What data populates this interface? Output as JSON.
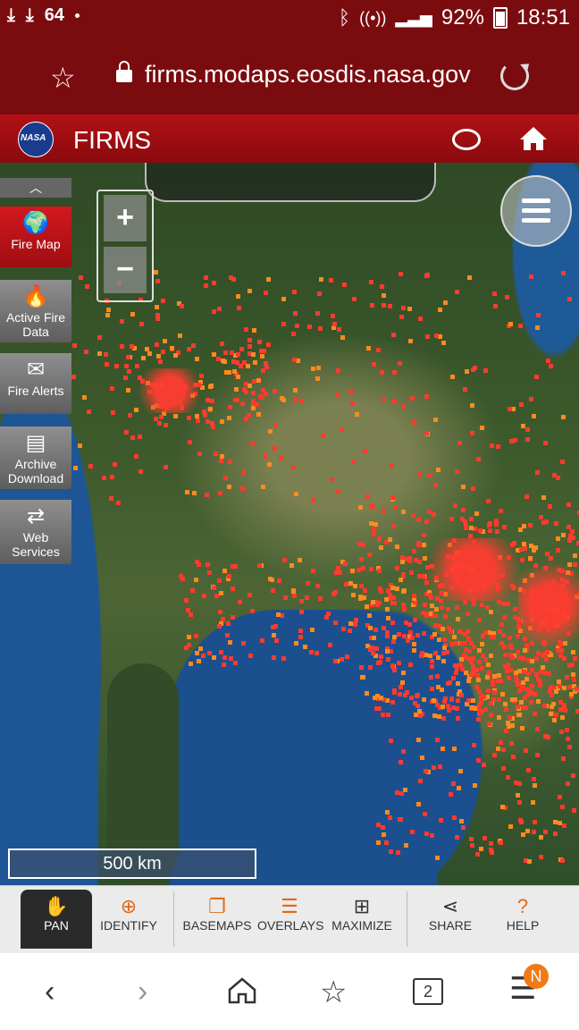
{
  "status_bar": {
    "notif_count": "64",
    "battery": "92%",
    "time": "18:51"
  },
  "browser": {
    "url": "firms.modaps.eosdis.nasa.gov",
    "tab_count": "2",
    "menu_badge": "N"
  },
  "app": {
    "logo_text": "NASA",
    "title": "FIRMS"
  },
  "sidebar": {
    "items": [
      {
        "label": "Fire Map",
        "icon": "globe-icon"
      },
      {
        "label": "Active Fire Data",
        "icon": "flame-icon"
      },
      {
        "label": "Fire Alerts",
        "icon": "envelope-icon"
      },
      {
        "label": "Archive Download",
        "icon": "archive-icon"
      },
      {
        "label": "Web Services",
        "icon": "arrows-icon"
      }
    ]
  },
  "map": {
    "zoom_in": "+",
    "zoom_out": "−",
    "scale_label": "500 km"
  },
  "toolbar": {
    "items": [
      {
        "label": "PAN",
        "icon": "hand-icon"
      },
      {
        "label": "IDENTIFY",
        "icon": "crosshair-icon"
      },
      {
        "label": "BASEMAPS",
        "icon": "layers-icon"
      },
      {
        "label": "OVERLAYS",
        "icon": "database-icon"
      },
      {
        "label": "MAXIMIZE",
        "icon": "maximize-icon"
      },
      {
        "label": "SHARE",
        "icon": "share-icon"
      },
      {
        "label": "HELP",
        "icon": "help-icon"
      }
    ]
  },
  "colors": {
    "brand_red": "#b11116",
    "fire_red": "#ff3a2e",
    "fire_orange": "#ff8a1e",
    "accent_orange": "#f07a14"
  }
}
